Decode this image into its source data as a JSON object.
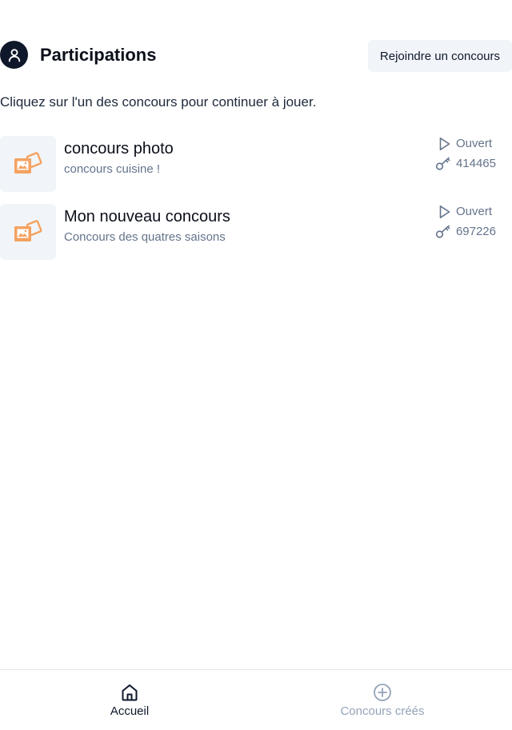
{
  "header": {
    "title": "Participations",
    "join_button_label": "Rejoindre un concours"
  },
  "intro_text": "Cliquez sur l'un des concours pour continuer à jouer.",
  "contests": [
    {
      "name": "concours photo",
      "description": "concours cuisine !",
      "status": "Ouvert",
      "code": "414465"
    },
    {
      "name": "Mon nouveau concours",
      "description": "Concours des quatres saisons",
      "status": "Ouvert",
      "code": "697226"
    }
  ],
  "bottom_nav": {
    "items": [
      {
        "label": "Accueil",
        "icon": "home-icon",
        "active": true
      },
      {
        "label": "Concours créés",
        "icon": "plus-circle-icon",
        "active": false
      }
    ]
  },
  "colors": {
    "text_primary": "#0f172a",
    "text_muted": "#64748b",
    "nav_inactive": "#94a3b8",
    "surface": "#f1f5f9",
    "accent_image": "#f4a261"
  }
}
